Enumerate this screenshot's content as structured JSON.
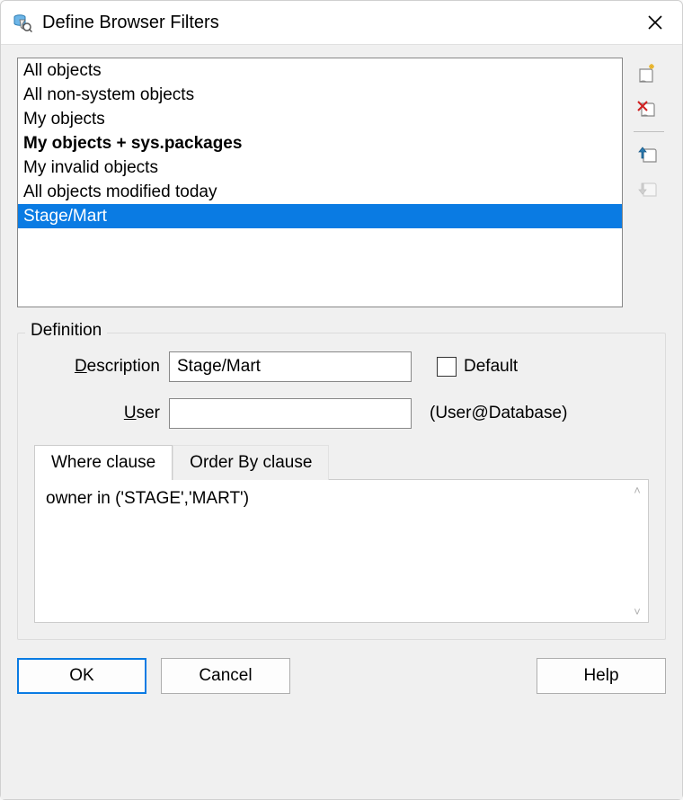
{
  "title": "Define Browser Filters",
  "filters": [
    {
      "label": "All objects",
      "bold": false,
      "selected": false
    },
    {
      "label": "All non-system objects",
      "bold": false,
      "selected": false
    },
    {
      "label": "My objects",
      "bold": false,
      "selected": false
    },
    {
      "label": "My objects + sys.packages",
      "bold": true,
      "selected": false
    },
    {
      "label": "My invalid objects",
      "bold": false,
      "selected": false
    },
    {
      "label": "All objects modified today",
      "bold": false,
      "selected": false
    },
    {
      "label": "Stage/Mart",
      "bold": false,
      "selected": true
    }
  ],
  "definition": {
    "legend": "Definition",
    "description_label_pre": "D",
    "description_label_rest": "escription",
    "description_value": "Stage/Mart",
    "default_label": "Default",
    "default_checked": false,
    "user_label_pre": "U",
    "user_label_rest": "ser",
    "user_value": "",
    "user_suffix": "(User@Database)",
    "tabs": {
      "where": "Where clause",
      "orderby": "Order By clause",
      "active": "where"
    },
    "where_text": "owner in ('STAGE','MART')"
  },
  "buttons": {
    "ok": "OK",
    "cancel": "Cancel",
    "help": "Help"
  }
}
